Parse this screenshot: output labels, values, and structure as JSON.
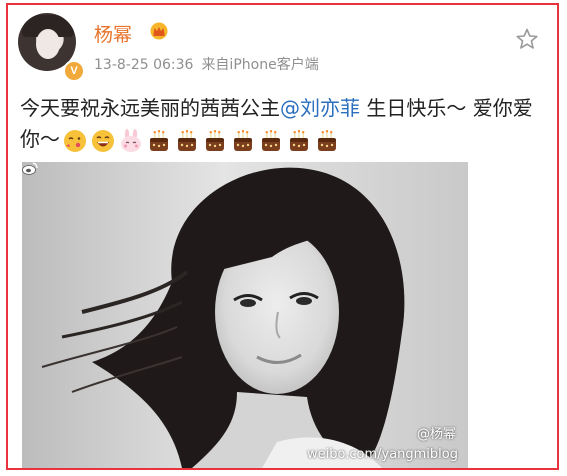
{
  "post": {
    "author": "杨幂",
    "time": "13-8-25 06:36",
    "source": "来自iPhone客户端",
    "text_before": "今天要祝永远美丽的茜茜公主",
    "mention": "@刘亦菲",
    "text_after": " 生日快乐～ 爱你爱你～",
    "emojis": [
      "kiss-emoji",
      "laugh-emoji",
      "bunny-emoji",
      "cake-emoji",
      "cake-emoji",
      "cake-emoji",
      "cake-emoji",
      "cake-emoji",
      "cake-emoji",
      "cake-emoji"
    ]
  },
  "photo": {
    "watermark_name": "@杨幂",
    "watermark_url": "weibo.com/yangmiblog"
  },
  "colors": {
    "frame": "#e8323c",
    "username": "#e8732a",
    "mention": "#2a6ebd",
    "meta": "#8f8f8f",
    "verified": "#f2a93b"
  },
  "icons": [
    "crown-icon",
    "star-icon",
    "verified-icon",
    "weibo-logo-icon"
  ]
}
